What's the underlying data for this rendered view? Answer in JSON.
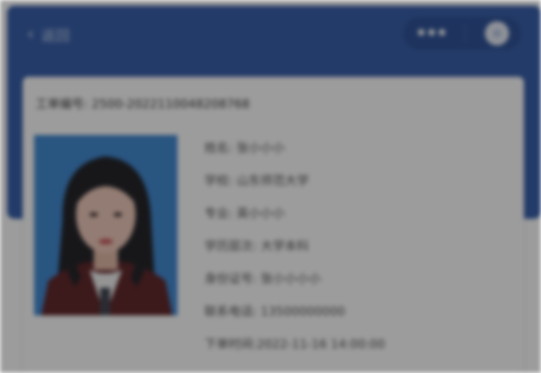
{
  "nav": {
    "back_icon": "chevron-left-icon",
    "back_label": "返回",
    "more_icon": "more-dots-icon",
    "close_icon": "target-circle-icon"
  },
  "ticket": {
    "number": "工单编号: 2500-2022110048208768"
  },
  "info": {
    "rows": [
      "姓名: 张小小小",
      "学校: 山东师范大学",
      "专业: 英小小小",
      "学历层次: 大学本科",
      "身份证号: 张小小小小",
      "联系电话: 13500000000",
      "下单时间:2022-11-16 14:00:00"
    ]
  },
  "colors": {
    "header": "#2f58a8",
    "photo_bg": "#3a86d0",
    "card": "#ffffff"
  }
}
